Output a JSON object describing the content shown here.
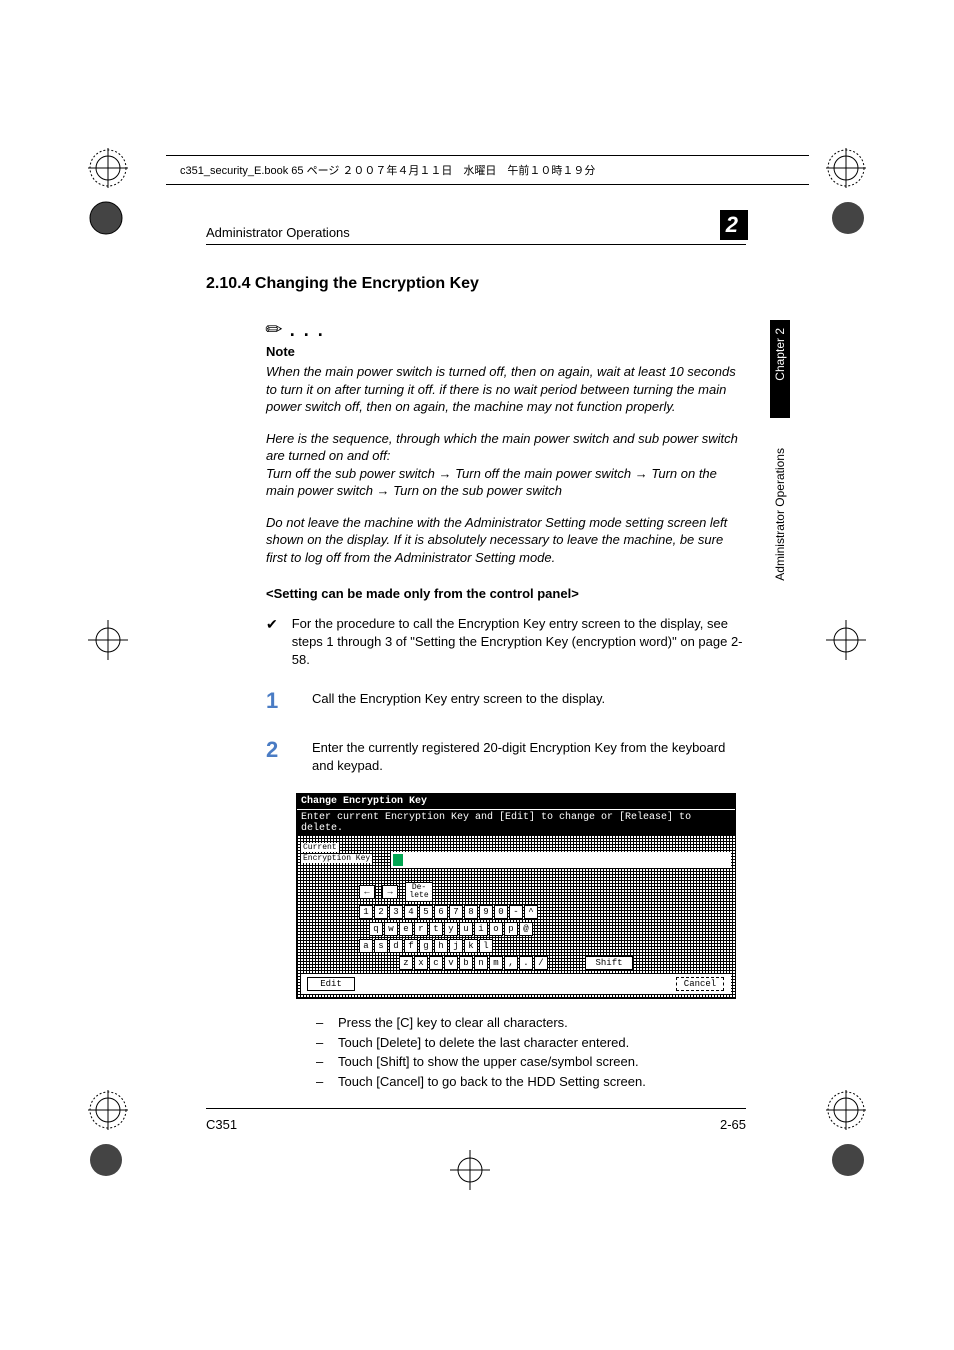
{
  "crop_header": "c351_security_E.book  65 ページ  ２００７年４月１１日　水曜日　午前１０時１９分",
  "running_head": "Administrator Operations",
  "chapter_box": "2",
  "side_tab_black": "Chapter 2",
  "side_tab_white": "Administrator Operations",
  "section_heading": "2.10.4  Changing the Encryption Key",
  "note": {
    "label": "Note",
    "para1": "When the main power switch is turned off, then on again, wait at least 10 seconds to turn it on after turning it off. if there is no wait period between turning the main power switch off, then on again, the machine may not function properly.",
    "para2": "Here is the sequence, through which the main power switch and sub power switch are turned on and off:",
    "para3a": "Turn off the sub power switch ",
    "para3b": " Turn off the main power switch ",
    "para3c": " Turn on the main power switch ",
    "para3d": " Turn on the sub power switch",
    "para4": "Do not leave the machine with the Administrator Setting mode setting screen left shown on the display. If it is absolutely necessary to leave the machine, be sure first to log off from the Administrator Setting mode."
  },
  "sub_heading": "<Setting can be made only from the control panel>",
  "check_item": "For the procedure to call the Encryption Key entry screen to the display, see steps 1 through 3 of \"Setting the Encryption Key (encryption word)\" on page 2-58.",
  "steps": {
    "s1": {
      "num": "1",
      "text": "Call the Encryption Key entry screen to the display."
    },
    "s2": {
      "num": "2",
      "text": "Enter the currently registered 20-digit Encryption Key from the keyboard and keypad."
    }
  },
  "screenshot": {
    "title": "Change Encryption Key",
    "instr": "Enter current Encryption Key and [Edit] to change or [Release] to delete.",
    "label1": "Current",
    "label2": "Encryption Key",
    "nav": {
      "left": "←",
      "right": "→",
      "delete": "De-\nlete"
    },
    "row1": [
      "1",
      "2",
      "3",
      "4",
      "5",
      "6",
      "7",
      "8",
      "9",
      "0",
      "-",
      "^"
    ],
    "row2": [
      "q",
      "w",
      "e",
      "r",
      "t",
      "y",
      "u",
      "i",
      "o",
      "p",
      "@"
    ],
    "row3": [
      "a",
      "s",
      "d",
      "f",
      "g",
      "h",
      "j",
      "k",
      "l"
    ],
    "row4": [
      "z",
      "x",
      "c",
      "v",
      "b",
      "n",
      "m",
      ",",
      ".",
      "/"
    ],
    "shift": "Shift",
    "edit": "Edit",
    "cancel": "Cancel"
  },
  "sub_list": {
    "i1": "Press the [C] key to clear all characters.",
    "i2": "Touch [Delete] to delete the last character entered.",
    "i3": "Touch [Shift] to show the upper case/symbol screen.",
    "i4": "Touch [Cancel] to go back to the HDD Setting screen."
  },
  "footer": {
    "left": "C351",
    "right": "2-65"
  }
}
